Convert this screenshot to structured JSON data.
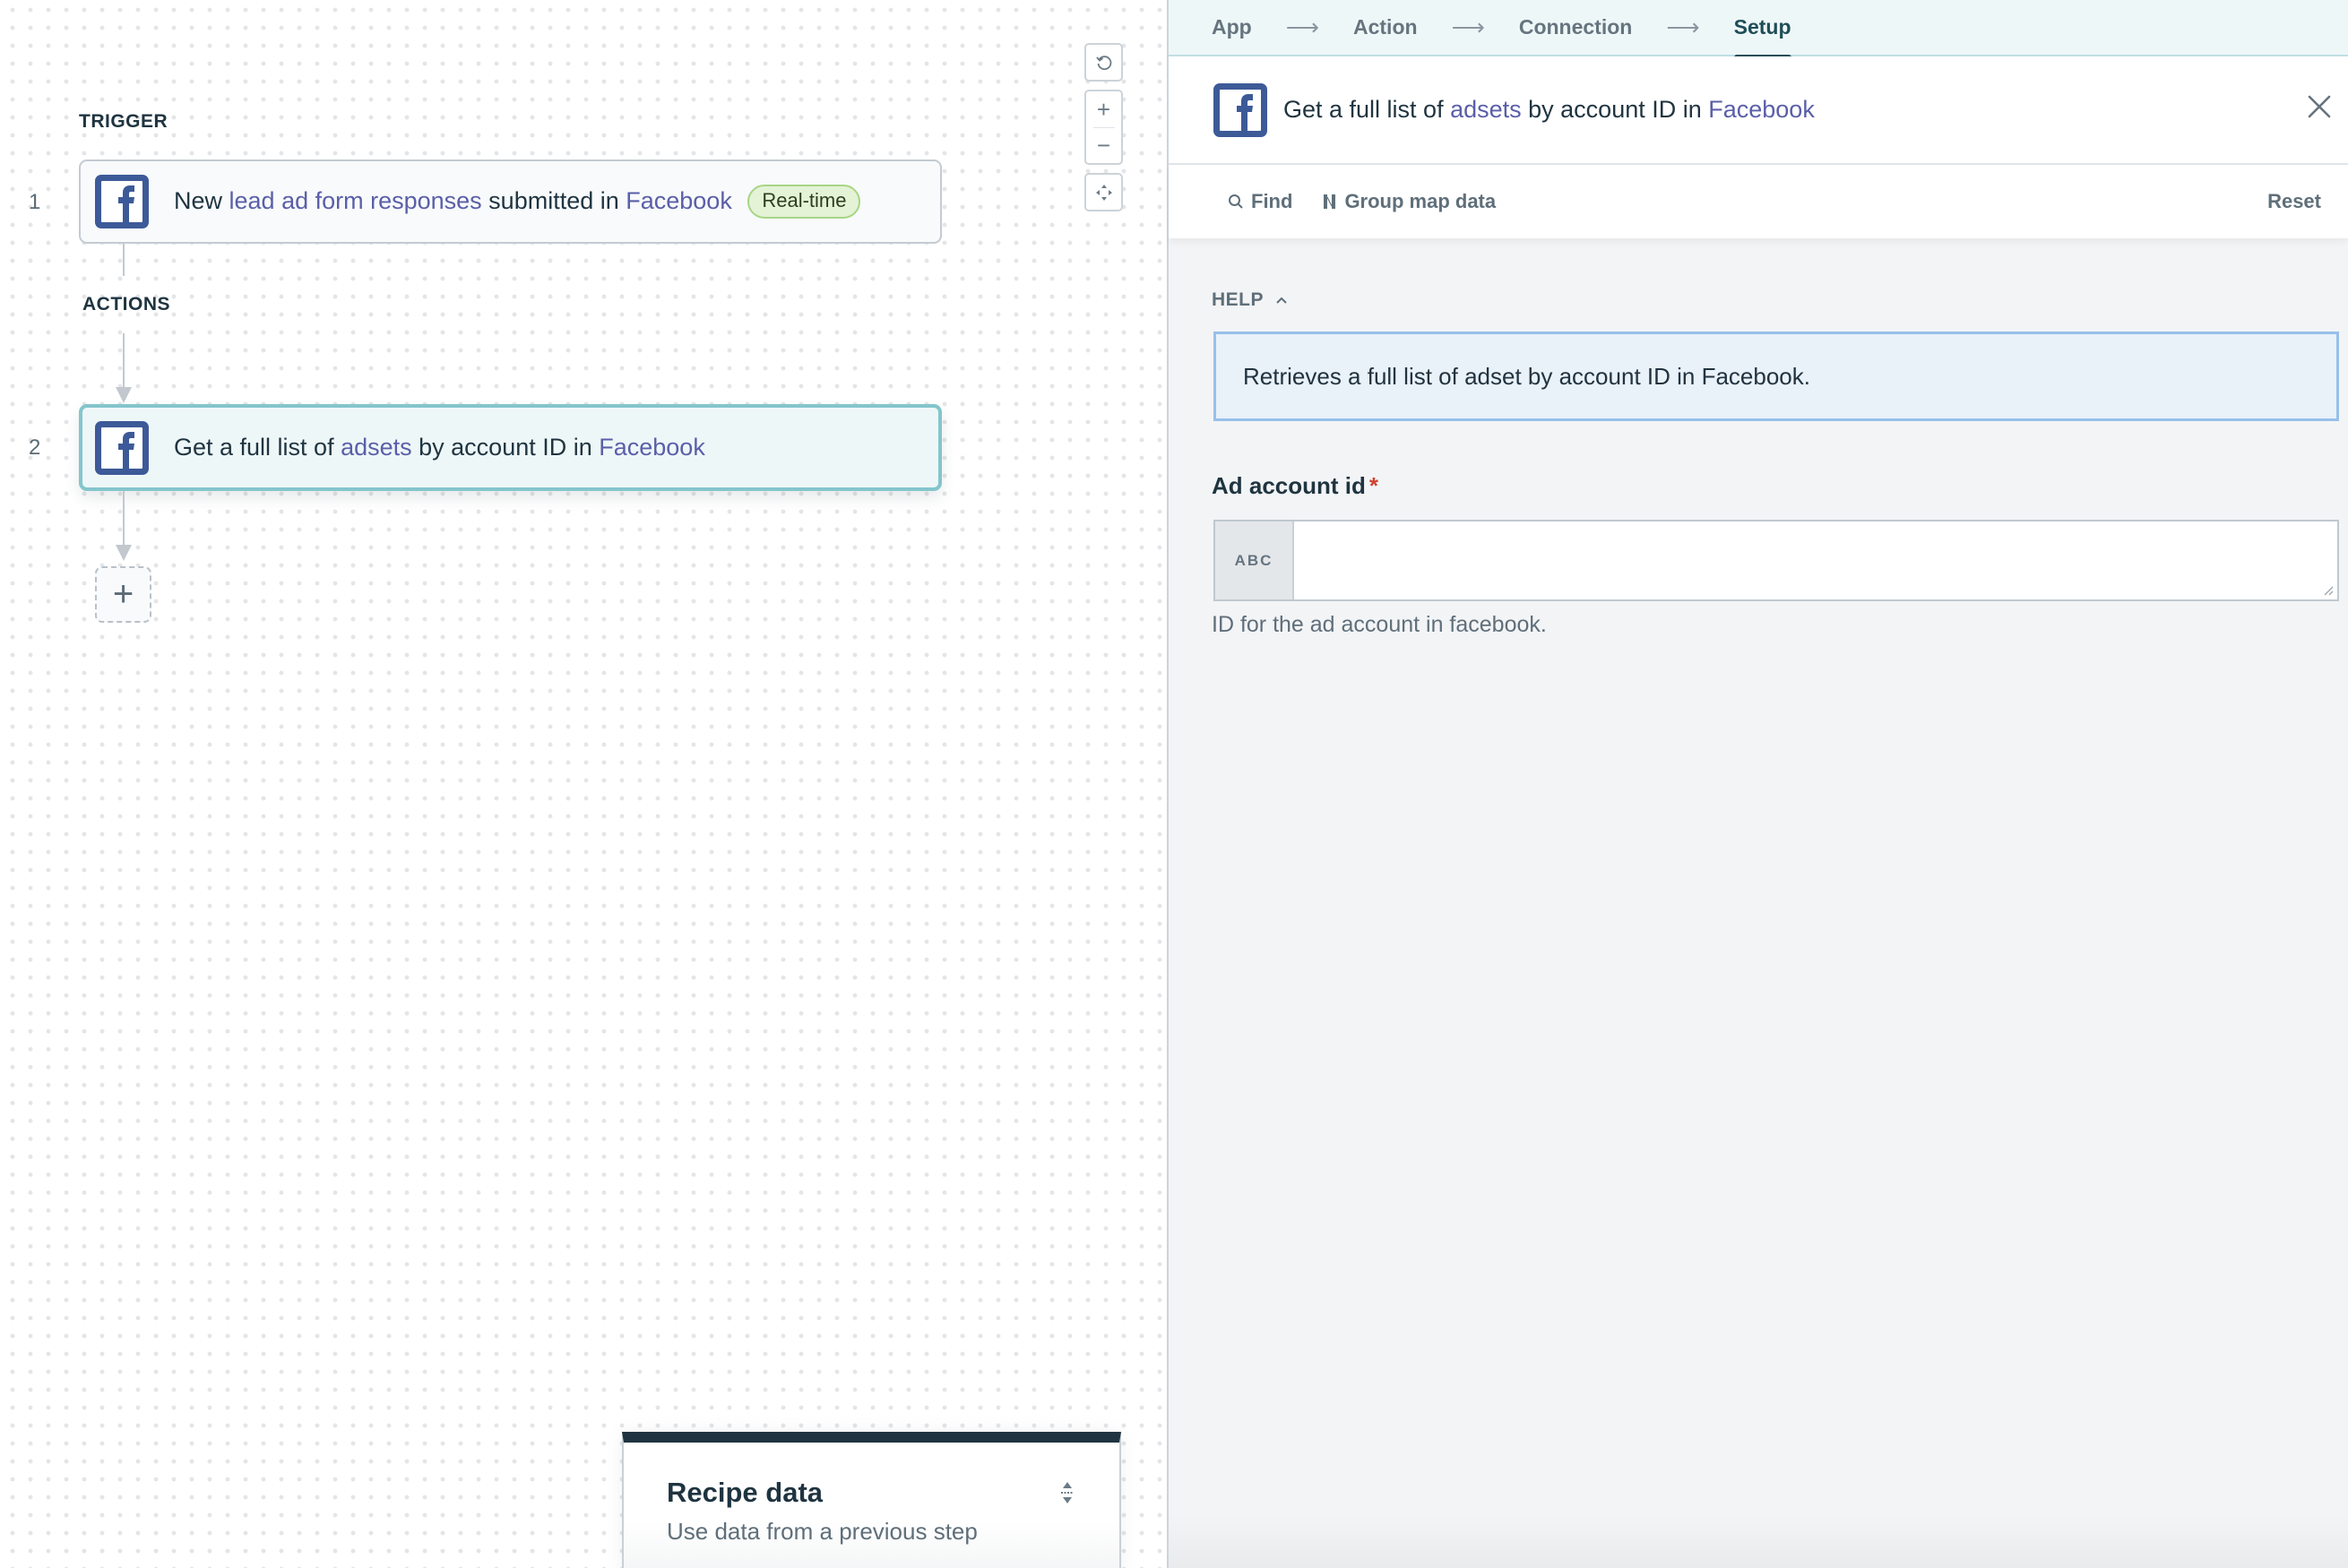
{
  "canvas": {
    "trigger_label": "TRIGGER",
    "actions_label": "ACTIONS",
    "steps": [
      {
        "number": "1",
        "app_icon": "facebook-icon",
        "text_parts": [
          {
            "text": "New ",
            "link": false
          },
          {
            "text": "lead ad form responses",
            "link": true
          },
          {
            "text": " submitted in ",
            "link": false
          },
          {
            "text": "Facebook",
            "link": true
          }
        ],
        "badge": "Real-time"
      },
      {
        "number": "2",
        "app_icon": "facebook-icon",
        "text_parts": [
          {
            "text": "Get a full list of ",
            "link": false
          },
          {
            "text": "adsets",
            "link": true
          },
          {
            "text": " by account ID in ",
            "link": false
          },
          {
            "text": "Facebook",
            "link": true
          }
        ],
        "active": true
      }
    ],
    "add_step_label": "+",
    "zoom_controls": {
      "reset_icon": "refresh-icon",
      "zoom_in": "+",
      "zoom_out": "−",
      "fit_icon": "fit-view-icon"
    },
    "recipe_data": {
      "title": "Recipe data",
      "subtitle": "Use data from a previous step"
    }
  },
  "panel": {
    "breadcrumbs": [
      {
        "label": "App",
        "current": false
      },
      {
        "label": "Action",
        "current": false
      },
      {
        "label": "Connection",
        "current": false
      },
      {
        "label": "Setup",
        "current": true
      }
    ],
    "header": {
      "title_parts": [
        {
          "text": "Get a full list of ",
          "link": false
        },
        {
          "text": "adsets",
          "link": true
        },
        {
          "text": " by account ID in ",
          "link": false
        },
        {
          "text": "Facebook",
          "link": true
        }
      ]
    },
    "toolbar": {
      "find_label": "Find",
      "group_map_label": "Group map data",
      "reset_label": "Reset"
    },
    "help": {
      "label": "HELP",
      "text": "Retrieves a full list of adset by account ID in Facebook."
    },
    "fields": [
      {
        "label": "Ad account id",
        "required": true,
        "required_mark": "*",
        "type_tag": "ABC",
        "value": "",
        "hint": "ID for the ad account in facebook."
      }
    ]
  },
  "colors": {
    "link": "#5a5fa8",
    "facebook": "#3d5a98",
    "active_border": "#84c5cc",
    "badge_bg": "#e4f2d6",
    "required": "#d0432f"
  }
}
